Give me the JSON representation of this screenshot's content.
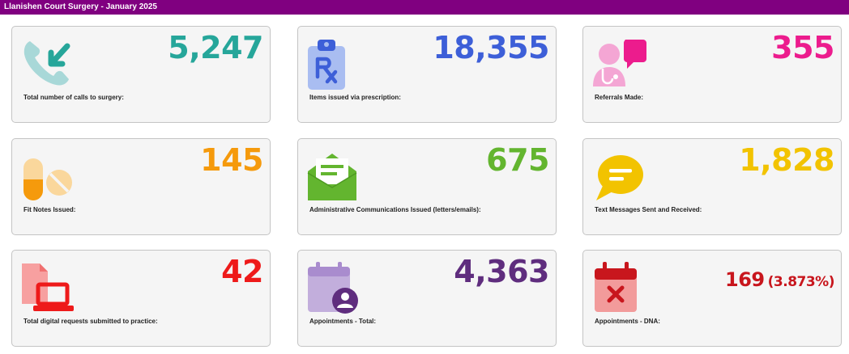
{
  "header": {
    "title": "Llanishen Court Surgery - January 2025"
  },
  "cards": [
    {
      "value": "5,247",
      "label": "Total number of calls to surgery:",
      "color": "#26a69a",
      "icon": "phone-incoming-icon"
    },
    {
      "value": "18,355",
      "label": "Items issued via prescription:",
      "color": "#3d5fd8",
      "icon": "prescription-icon"
    },
    {
      "value": "355",
      "label": "Referrals Made:",
      "color": "#ec1c8d",
      "icon": "doctor-chat-icon"
    },
    {
      "value": "145",
      "label": "Fit Notes Issued:",
      "color": "#f59a0c",
      "icon": "pills-icon"
    },
    {
      "value": "675",
      "label": "Administrative Communications Issued (letters/emails):",
      "color": "#63b52f",
      "icon": "envelope-open-icon"
    },
    {
      "value": "1,828",
      "label": "Text Messages Sent and Received:",
      "color": "#f2c300",
      "icon": "chat-bubble-icon"
    },
    {
      "value": "42",
      "label": "Total digital requests submitted to practice:",
      "color": "#ee1a1a",
      "icon": "laptop-document-icon"
    },
    {
      "value": "4,363",
      "label": "Appointments - Total:",
      "color": "#5f2d7e",
      "icon": "calendar-person-icon"
    },
    {
      "value": "169",
      "value_sub": "(3.873%)",
      "label": "Appointments - DNA:",
      "color": "#c8161d",
      "icon": "calendar-cross-icon"
    }
  ]
}
